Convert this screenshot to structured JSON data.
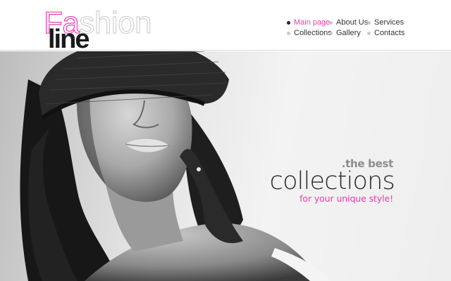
{
  "logo": {
    "word_pink_part": "Fa",
    "word_rest": "shion",
    "word_bold": "line"
  },
  "nav": {
    "items": [
      {
        "label": "Main page",
        "active": true
      },
      {
        "label": "About Us",
        "active": false
      },
      {
        "label": "Services",
        "active": false
      },
      {
        "label": "Collections",
        "active": false
      },
      {
        "label": "Gallery",
        "active": false
      },
      {
        "label": "Contacts",
        "active": false
      }
    ]
  },
  "hero": {
    "photo": "black-and-white-woman-knit-cap-icon",
    "tagline_small": ".the best",
    "tagline_big": "collections",
    "tagline_sub": "for your unique style!"
  },
  "colors": {
    "accent": "#e63fae",
    "text_dark": "#2a2a2a",
    "text_grey": "#8d8d8d",
    "bullet_inactive": "#c8c8c8"
  }
}
